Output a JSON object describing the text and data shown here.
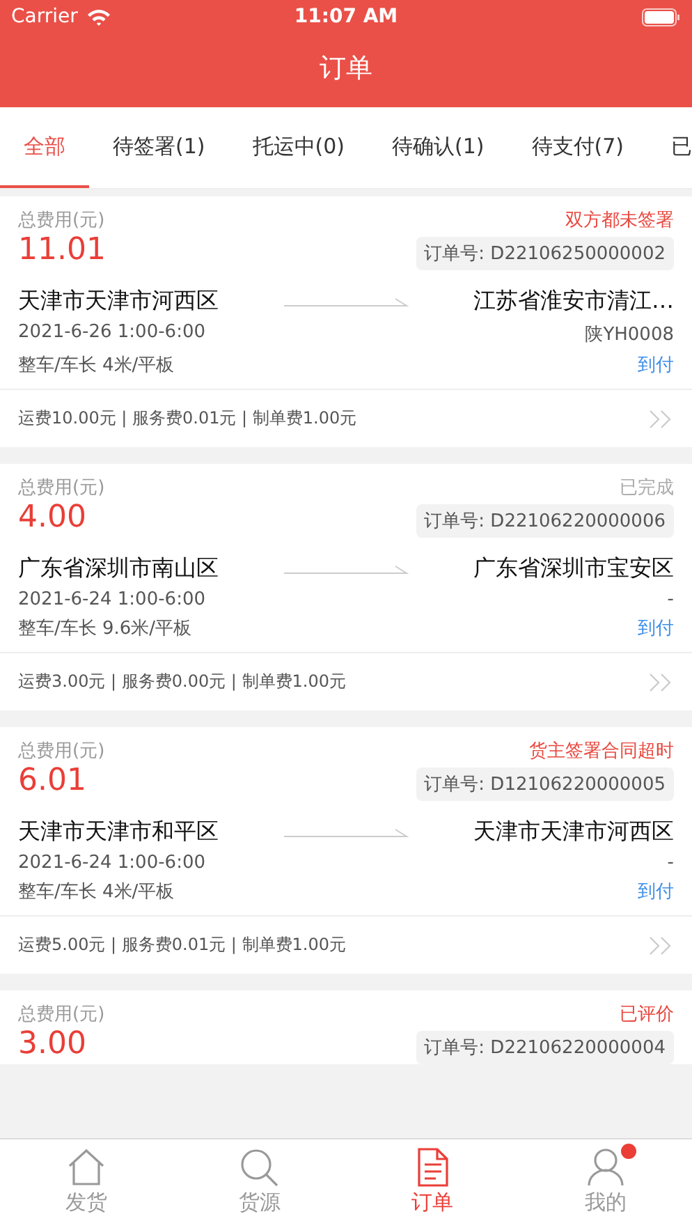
{
  "status_bar": {
    "carrier": "Carrier",
    "time": "11:07 AM"
  },
  "title": "订单",
  "tabs": [
    {
      "label": "全部",
      "selected": true
    },
    {
      "label": "待签署(1)",
      "selected": false
    },
    {
      "label": "托运中(0)",
      "selected": false
    },
    {
      "label": "待确认(1)",
      "selected": false
    },
    {
      "label": "待支付(7)",
      "selected": false
    },
    {
      "label": "已",
      "selected": false
    }
  ],
  "orders": [
    {
      "total_label": "总费用(元)",
      "total": "11.01",
      "status": "双方都未签署",
      "color": "#e8483f",
      "order_no": "订单号: D22106250000002",
      "from": "天津市天津市河西区",
      "to": "江苏省淮安市清江…",
      "date": "2021-6-26  1:00-6:00",
      "plate": "陕YH0008",
      "vehicle": "整车/车长 4米/平板",
      "payment": "到付",
      "fees": "运费10.00元 | 服务费0.01元 | 制单费1.00元"
    },
    {
      "total_label": "总费用(元)",
      "total": "4.00",
      "status": "已完成",
      "color": "#aaaaaa",
      "order_no": "订单号: D22106220000006",
      "from": "广东省深圳市南山区",
      "to": "广东省深圳市宝安区",
      "date": "2021-6-24  1:00-6:00",
      "plate": "-",
      "vehicle": "整车/车长 9.6米/平板",
      "payment": "到付",
      "fees": "运费3.00元 | 服务费0.00元 | 制单费1.00元"
    },
    {
      "total_label": "总费用(元)",
      "total": "6.01",
      "status": "货主签署合同超时",
      "color": "#e8483f",
      "order_no": "订单号: D12106220000005",
      "from": "天津市天津市和平区",
      "to": "天津市天津市河西区",
      "date": "2021-6-24  1:00-6:00",
      "plate": "-",
      "vehicle": "整车/车长 4米/平板",
      "payment": "到付",
      "fees": "运费5.00元 | 服务费0.01元 | 制单费1.00元"
    },
    {
      "total_label": "总费用(元)",
      "total": "3.00",
      "status": "已评价",
      "color": "#e8483f",
      "order_no": "订单号: D22106220000004"
    }
  ],
  "nav": [
    {
      "label": "发货",
      "kind": "home",
      "selected": false,
      "badge": false
    },
    {
      "label": "货源",
      "kind": "search",
      "selected": false,
      "badge": false
    },
    {
      "label": "订单",
      "kind": "document",
      "selected": true,
      "badge": false
    },
    {
      "label": "我的",
      "kind": "person",
      "selected": false,
      "badge": true
    }
  ]
}
